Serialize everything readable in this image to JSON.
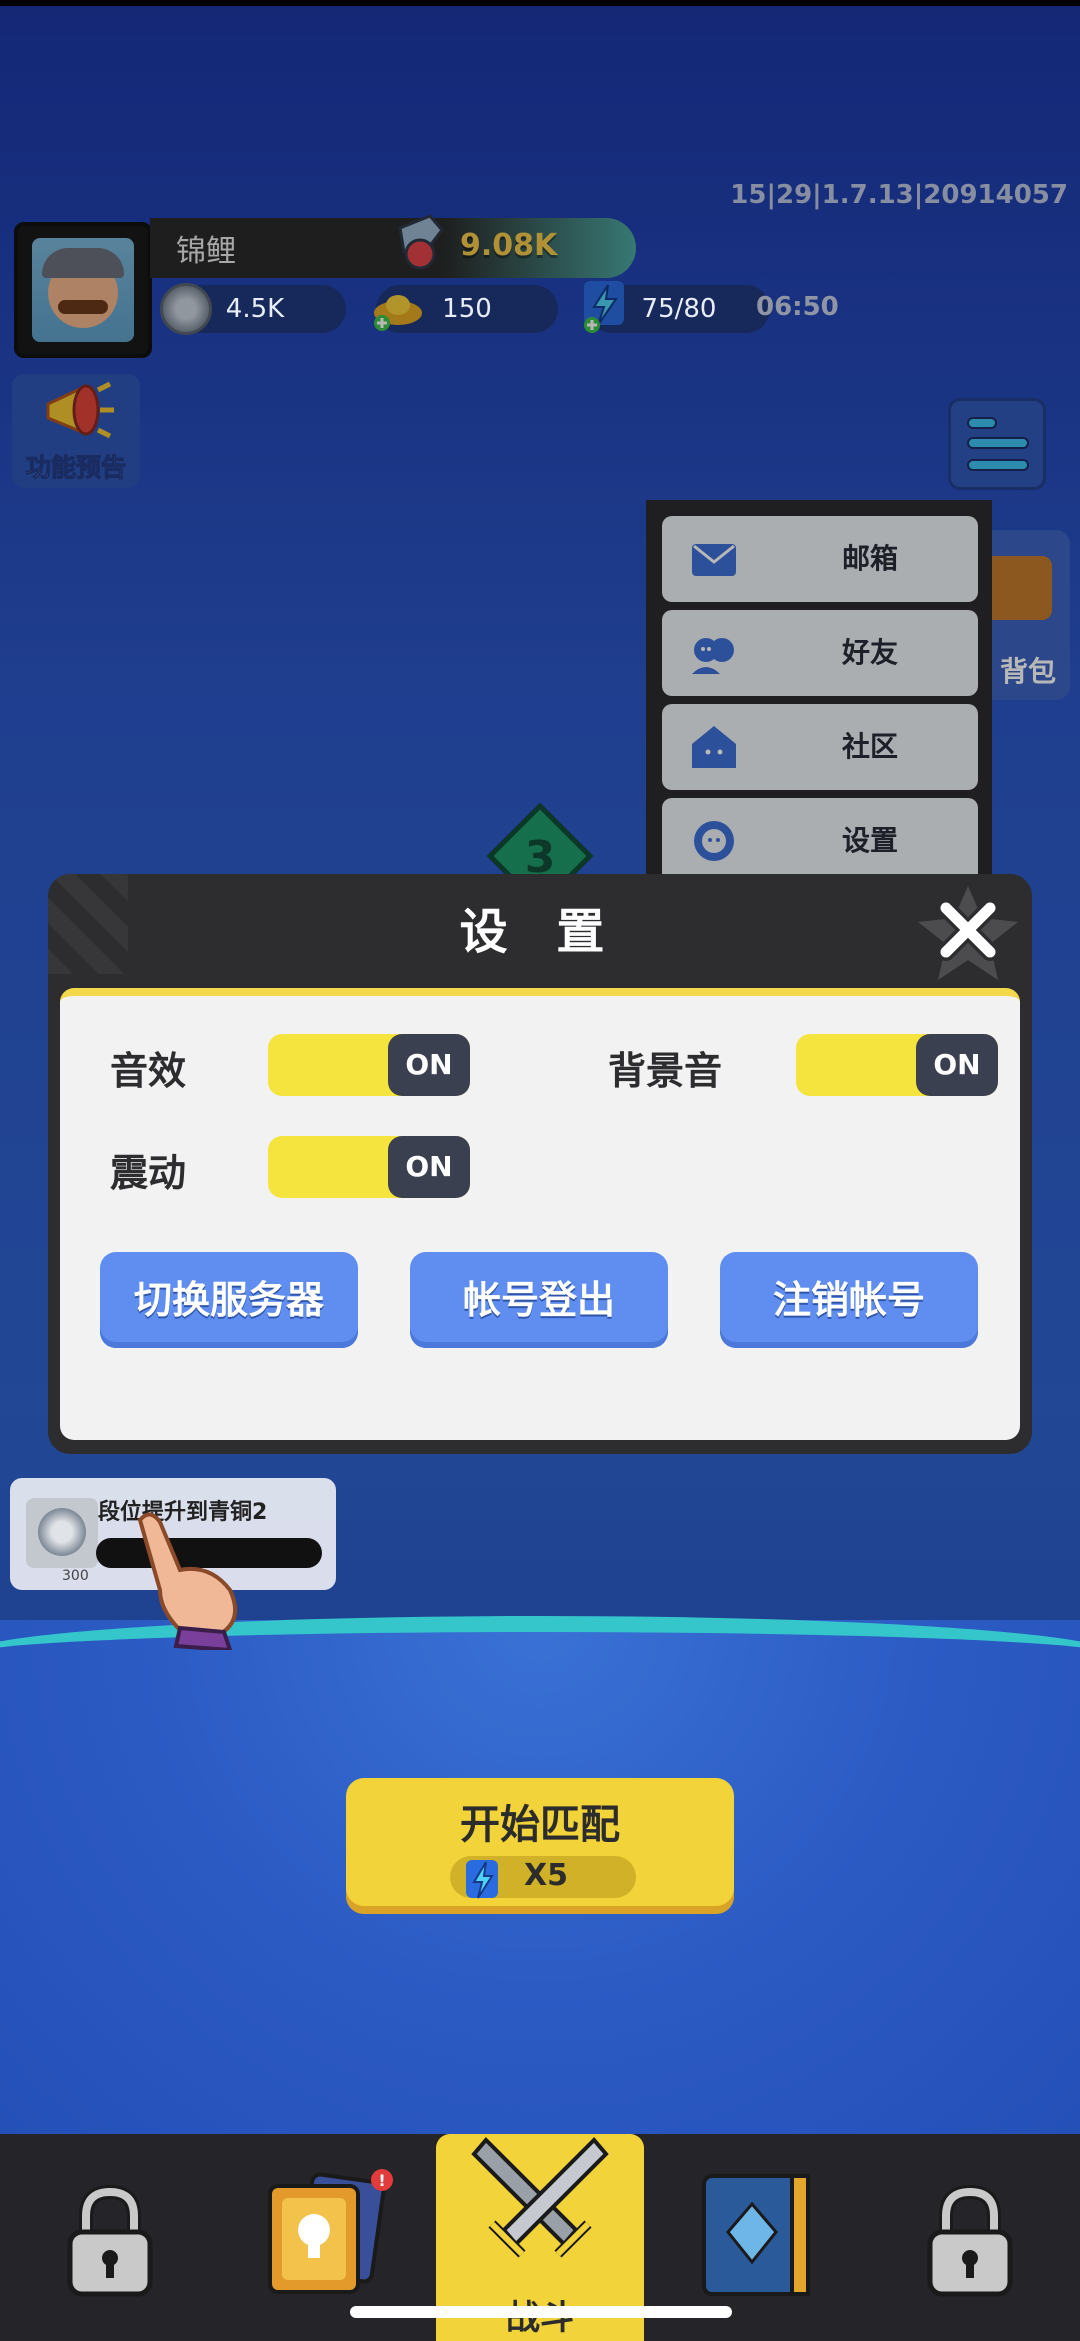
{
  "header": {
    "version": "15|29|1.7.13|20914057",
    "player_name": "锦鲤",
    "trophy_score": "9.08K",
    "coins": "4.5K",
    "gold": "150",
    "energy": "75/80",
    "timer": "06:50",
    "feature_preview_label": "功能预告"
  },
  "side_menu": {
    "items": [
      {
        "label": "邮箱",
        "icon": "mail-icon"
      },
      {
        "label": "好友",
        "icon": "friends-icon"
      },
      {
        "label": "社区",
        "icon": "community-icon"
      },
      {
        "label": "设置",
        "icon": "gear-icon"
      }
    ],
    "bag_label": "背包"
  },
  "level_badge": "3",
  "settings_modal": {
    "title": "设 置",
    "sound_label": "音效",
    "sound_state": "ON",
    "bgm_label": "背景音",
    "bgm_state": "ON",
    "vibration_label": "震动",
    "vibration_state": "ON",
    "switch_server_label": "切换服务器",
    "logout_label": "帐号登出",
    "delete_account_label": "注销帐号"
  },
  "rank_task": {
    "text": "段位提升到青铜2",
    "reward": "300"
  },
  "match": {
    "label": "开始匹配",
    "cost": "X5"
  },
  "bottom_nav": {
    "active_label": "战斗"
  },
  "colors": {
    "accent_yellow": "#f2d33a",
    "toggle_on": "#f6e43e",
    "button_blue": "#5f8ef0",
    "modal_dark": "#2d2d30"
  }
}
